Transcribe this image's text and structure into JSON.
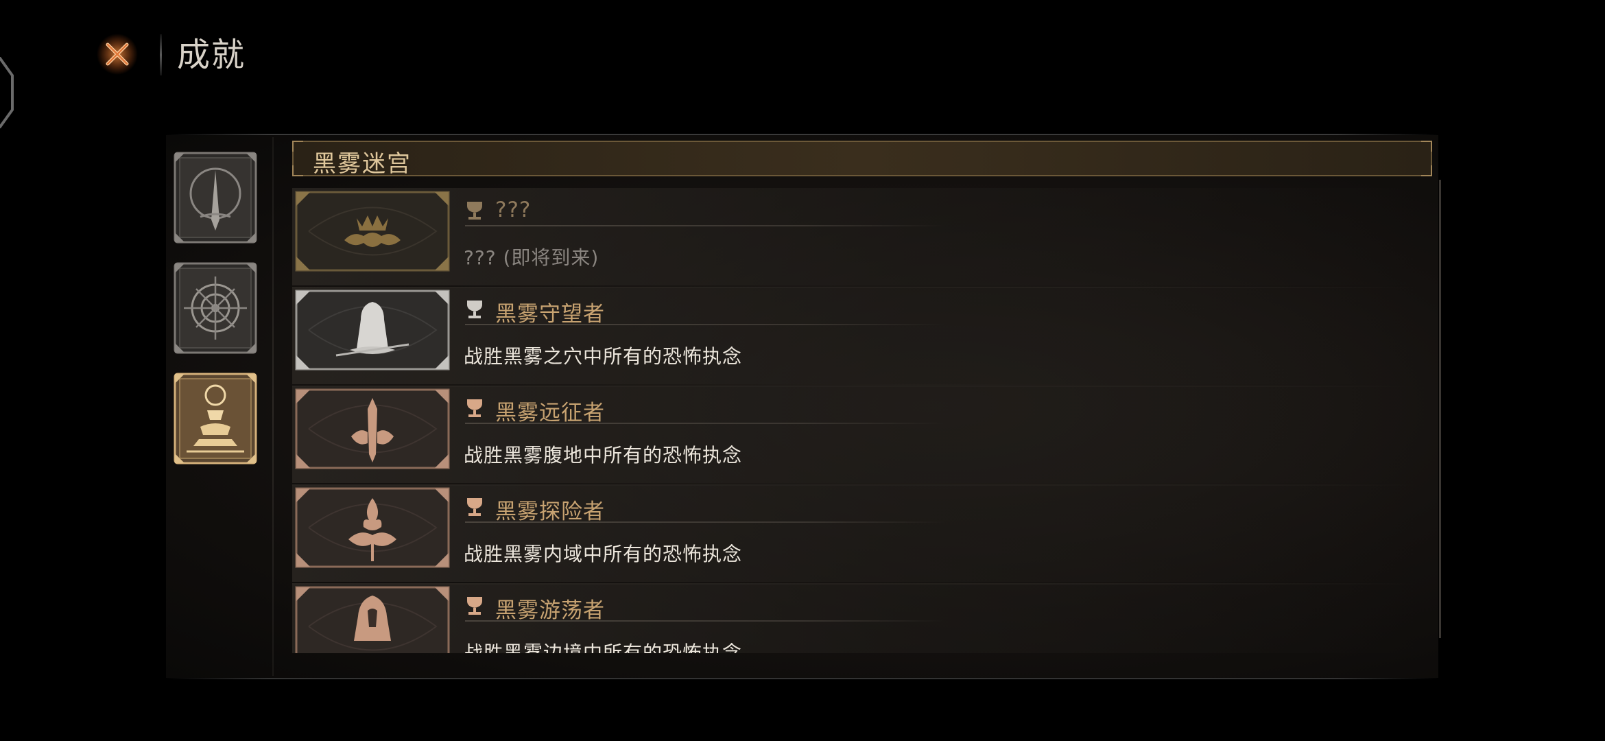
{
  "page": {
    "title": "成就"
  },
  "colors": {
    "title_active": "#c8a371",
    "title_locked": "#8f7a5c",
    "desc_active": "#ece6dc",
    "desc_locked": "#8a8580",
    "accent_orange": "#e0783a"
  },
  "categories": [
    {
      "name": "category-tab-1",
      "icon": "spire-sigil-icon",
      "selected": false
    },
    {
      "name": "category-tab-2",
      "icon": "crosshair-compass-icon",
      "selected": false
    },
    {
      "name": "category-tab-3",
      "icon": "altar-relic-icon",
      "selected": true
    }
  ],
  "list": {
    "header": "黑雾迷宫",
    "achievements": [
      {
        "title": "???",
        "description": "??? (即将到来)",
        "locked": true,
        "icon": "crown-cloud-icon"
      },
      {
        "title": "黑雾守望者",
        "description": "战胜黑雾之穴中所有的恐怖执念",
        "locked": false,
        "icon": "hooded-watcher-icon"
      },
      {
        "title": "黑雾远征者",
        "description": "战胜黑雾腹地中所有的恐怖执念",
        "locked": false,
        "icon": "sword-cloud-icon"
      },
      {
        "title": "黑雾探险者",
        "description": "战胜黑雾内域中所有的恐怖执念",
        "locked": false,
        "icon": "flame-cloud-icon"
      },
      {
        "title": "黑雾游荡者",
        "description": "战胜黑雾边境中所有的恐怖执念",
        "locked": false,
        "icon": "hooded-wanderer-icon"
      }
    ]
  }
}
